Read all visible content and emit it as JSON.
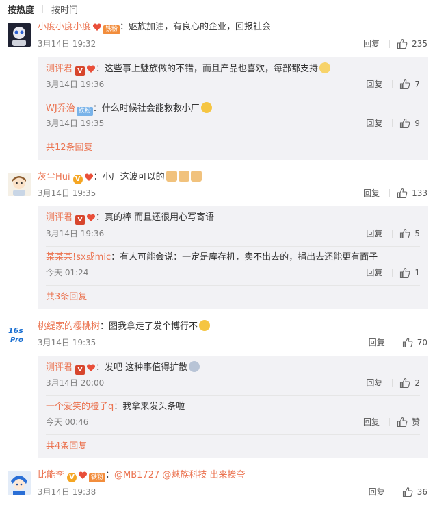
{
  "tabs": {
    "hot": "按热度",
    "time": "按时间"
  },
  "colors": {
    "username": "#eb7350",
    "bg_reply": "#f2f2f5",
    "badge_tie": "#f28d3c",
    "badge_tie_blue": "#79b3e9"
  },
  "reply_label": "回复",
  "comments": [
    {
      "user": "小度小度小度",
      "badge": "铁粉",
      "sep": "：",
      "text": "魅族加油，有良心的企业，回报社会",
      "time": "3月14日 19:32",
      "likes": "235",
      "replies": [
        {
          "user": "测评君",
          "sep": "：",
          "text": "这些事上魅族做的不错，而且产品也喜欢，每部都支持",
          "time": "3月14日 19:36",
          "likes": "7"
        },
        {
          "user": "WJ乔治",
          "badge": "铁粉",
          "sep": "：",
          "text": "什么时候社会能救救小厂",
          "time": "3月14日 19:35",
          "likes": "9"
        }
      ],
      "more": "共12条回复"
    },
    {
      "user": "灰尘Hui",
      "sep": "：",
      "text": "小厂这波可以的",
      "time": "3月14日 19:35",
      "likes": "133",
      "replies": [
        {
          "user": "测评君",
          "sep": "：",
          "text": "真的棒 而且还很用心写寄语",
          "time": "3月14日 19:36",
          "likes": "5"
        },
        {
          "user": "某某某!sx或mic",
          "sep": "：",
          "text": "有人可能会说：一定是库存机，卖不出去的，捐出去还能更有面子",
          "time": "今天 01:24",
          "likes": "1"
        }
      ],
      "more": "共3条回复"
    },
    {
      "user": "桃缇家的樱桃树",
      "sep": "：",
      "text": "图我拿走了发个博行不",
      "time": "3月14日 19:35",
      "likes": "70",
      "replies": [
        {
          "user": "测评君",
          "sep": "：",
          "text": "发吧 这种事值得扩散",
          "time": "3月14日 20:00",
          "likes": "2"
        },
        {
          "user": "一个爱笑的橙子q",
          "sep": "：",
          "text": "我拿来发头条啦",
          "time": "今天 00:46",
          "likes": "赞"
        }
      ],
      "more": "共4条回复"
    },
    {
      "user": "比能李",
      "badge": "铁粉",
      "sep": "：",
      "text": "@MB1727 @魅族科技 出来挨夸",
      "time": "3月14日 19:38",
      "likes": "36"
    }
  ]
}
